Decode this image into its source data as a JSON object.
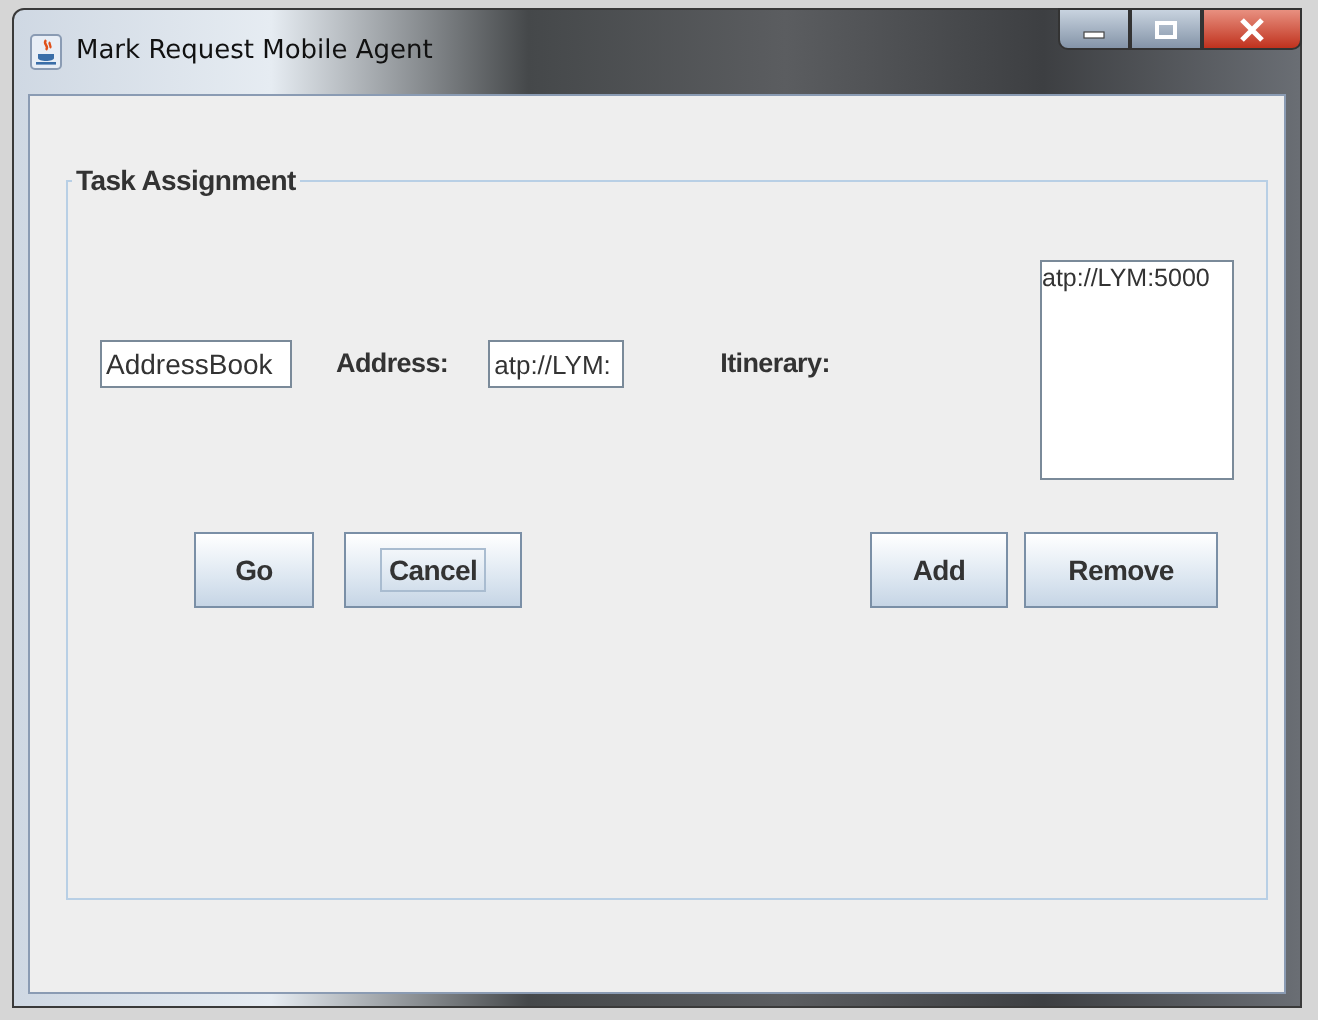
{
  "window": {
    "title": "Mark Request Mobile Agent"
  },
  "panel": {
    "title": "Task Assignment"
  },
  "agent_field": {
    "value": "AddressBook"
  },
  "address": {
    "label": "Address:",
    "value": "atp://LYM:"
  },
  "itinerary": {
    "label": "Itinerary:",
    "items": [
      "atp://LYM:5000"
    ]
  },
  "buttons": [
    {
      "label": "Go",
      "focused": false
    },
    {
      "label": "Cancel",
      "focused": true
    },
    {
      "label": "Add",
      "focused": false
    },
    {
      "label": "Remove",
      "focused": false
    }
  ]
}
